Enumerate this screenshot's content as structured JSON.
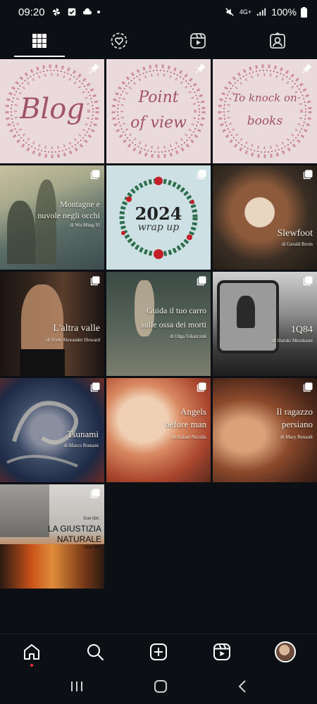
{
  "status_bar": {
    "time": "09:20",
    "network": "4G+",
    "battery": "100%"
  },
  "tabs": [
    {
      "name": "grid",
      "icon": "grid-icon",
      "active": true
    },
    {
      "name": "reposts",
      "icon": "repost-icon",
      "active": false
    },
    {
      "name": "reels",
      "icon": "reels-icon",
      "active": false
    },
    {
      "name": "tagged",
      "icon": "tagged-icon",
      "active": false
    }
  ],
  "posts": {
    "blog": {
      "text": "Blog"
    },
    "pov": {
      "line1": "Point",
      "line2": "of view"
    },
    "knock": {
      "line1": "To knock on",
      "line2": "books"
    },
    "montagne": {
      "title1": "Montagne e",
      "title2": "nuvole negli occhi",
      "author": "di Wu Ming-Yi"
    },
    "wrapup": {
      "year": "2024",
      "sub": "wrap up"
    },
    "slewfoot": {
      "title": "Slewfoot",
      "author": "di Gerald Brom"
    },
    "altravalle": {
      "title": "L'altra valle",
      "author": "di Scott Alexander Howard"
    },
    "guida": {
      "title1": "Guida il tuo carro",
      "title2": "sulle ossa dei morti",
      "author": "di Olga Tokarczuk"
    },
    "q84": {
      "title": "1Q84",
      "author": "di Haruki Murakami"
    },
    "tsunami": {
      "title": "Tsunami",
      "author": "di Marco Romani"
    },
    "angels": {
      "title1": "Angels",
      "title2": "before man",
      "author": "di Rafael Nicolás"
    },
    "ragazzo": {
      "title1": "Il ragazzo",
      "title2": "persiano",
      "author": "di Mary Renault"
    },
    "giustizia": {
      "label1": "Due libri.",
      "title1": "LA GIUSTIZIA",
      "title2": "NATURALE",
      "label2": "Due film"
    }
  },
  "colors": {
    "background": "#0c1014",
    "wreath_bg": "#eadadb",
    "accent_dot": "#ff3040",
    "script_text": "#a0526c"
  }
}
